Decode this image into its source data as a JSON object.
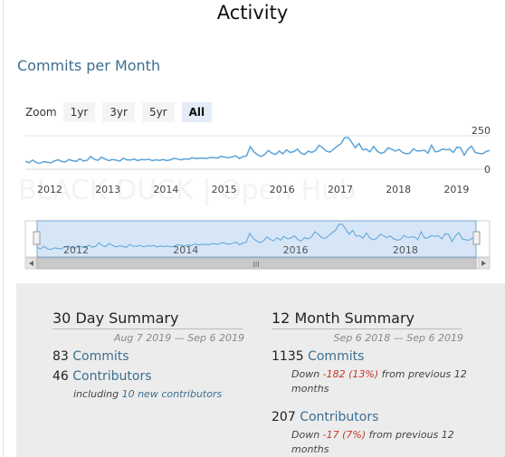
{
  "page": {
    "title": "Activity",
    "subtitle": "Commits per Month"
  },
  "zoom": {
    "label": "Zoom",
    "buttons": [
      "1yr",
      "3yr",
      "5yr",
      "All"
    ],
    "active": "All"
  },
  "chart_data": {
    "type": "line",
    "title": "Commits per Month",
    "x_tick_labels": [
      "2012",
      "2013",
      "2014",
      "2015",
      "2016",
      "2017",
      "2018",
      "2019"
    ],
    "y_tick_labels": [
      "250",
      "0"
    ],
    "ylim": [
      0,
      250
    ],
    "grid": true,
    "color": "#5aa3d8",
    "series": [
      {
        "values": [
          60,
          48,
          68,
          50,
          44,
          56,
          52,
          48,
          62,
          70,
          58,
          54,
          72,
          64,
          58,
          78,
          62,
          66,
          95,
          74,
          66,
          90,
          76,
          64,
          72,
          68,
          60,
          82,
          70,
          68,
          76,
          64,
          72,
          70,
          74,
          64,
          70,
          66,
          72,
          64,
          70,
          82,
          76,
          70,
          78,
          74,
          86,
          80,
          82,
          84,
          80,
          88,
          86,
          84,
          96,
          90,
          85,
          92,
          100,
          80,
          94,
          100,
          168,
          130,
          108,
          95,
          110,
          140,
          120,
          110,
          135,
          115,
          145,
          125,
          132,
          150,
          120,
          110,
          135,
          126,
          140,
          180,
          160,
          135,
          128,
          150,
          172,
          190,
          235,
          238,
          200,
          160,
          192,
          145,
          150,
          130,
          170,
          135,
          118,
          128,
          160,
          150,
          135,
          148,
          125,
          115,
          120,
          152,
          136,
          138,
          142,
          120,
          180,
          130,
          135,
          150,
          145,
          150,
          125,
          165,
          160,
          105,
          150,
          172,
          126,
          118,
          115,
          132,
          140
        ]
      }
    ],
    "navigator": {
      "tick_labels": [
        "2012",
        "2014",
        "2016",
        "2018"
      ],
      "scrollbar_glyph": "III"
    },
    "watermark": "BLACK DUCK | Open Hub"
  },
  "summary30": {
    "heading": "30 Day Summary",
    "range": "Aug 7 2019 — Sep 6 2019",
    "commits_count": "83",
    "commits_label": "Commits",
    "contributors_count": "46",
    "contributors_label": "Contributors",
    "new_prefix": "including ",
    "new_link": "10 new contributors"
  },
  "summary12": {
    "heading": "12 Month Summary",
    "range": "Sep 6 2018 — Sep 6 2019",
    "commits_count": "1135",
    "commits_label": "Commits",
    "commits_down_prefix": "Down ",
    "commits_down_value": "-182 (13%)",
    "commits_down_suffix": " from previous 12",
    "commits_down_line2": "months",
    "contributors_count": "207",
    "contributors_label": "Contributors",
    "contributors_down_prefix": "Down ",
    "contributors_down_value": "-17 (7%)",
    "contributors_down_suffix": " from previous 12",
    "contributors_down_line2": "months"
  }
}
